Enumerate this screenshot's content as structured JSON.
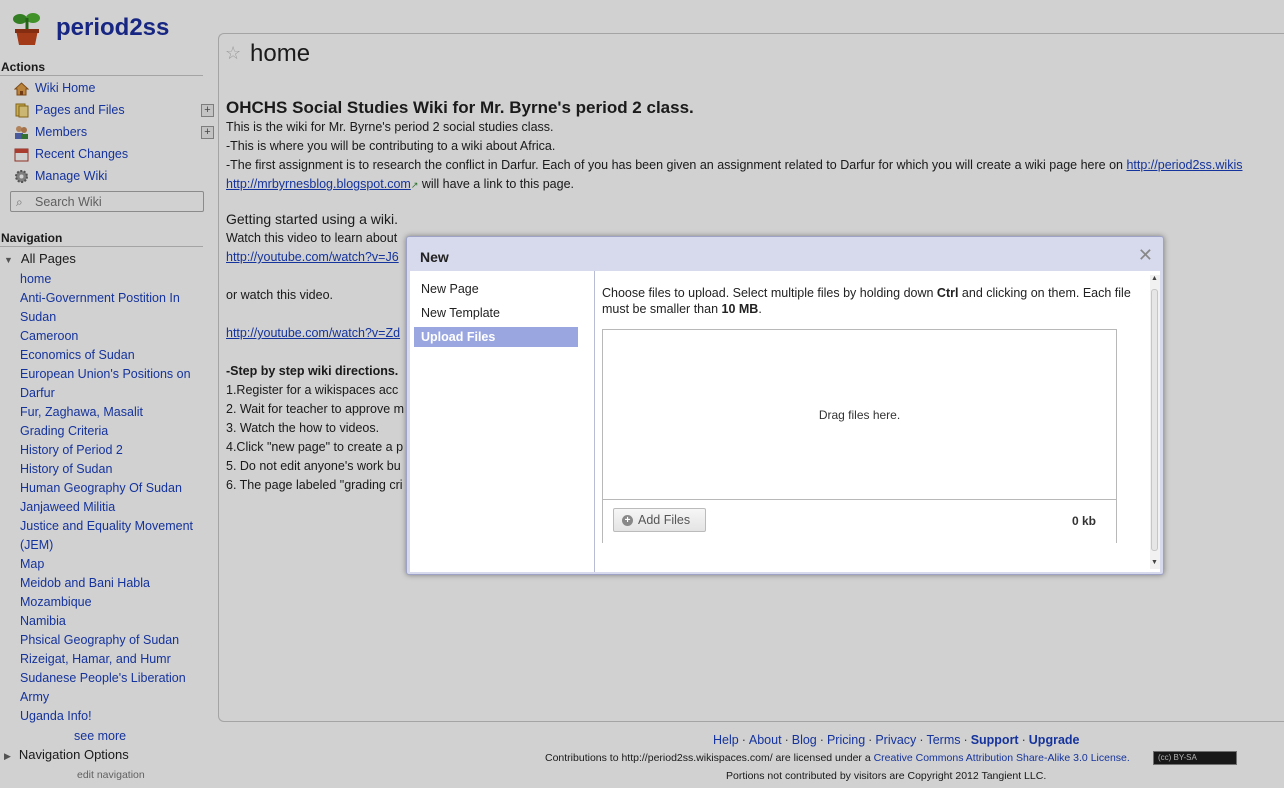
{
  "site": {
    "name": "period2ss"
  },
  "sidebar": {
    "actions_heading": "Actions",
    "actions": [
      {
        "label": "Wiki Home",
        "icon": "house-icon",
        "color": "#d9822b"
      },
      {
        "label": "Pages and Files",
        "icon": "files-icon",
        "color": "#e0b030"
      },
      {
        "label": "Members",
        "icon": "members-icon",
        "color": "#6a7fbf"
      },
      {
        "label": "Recent Changes",
        "icon": "calendar-icon",
        "color": "#d04a3a"
      },
      {
        "label": "Manage Wiki",
        "icon": "gear-icon",
        "color": "#8a8a8a"
      }
    ],
    "search_placeholder": "Search Wiki",
    "navigation_heading": "Navigation",
    "all_pages_label": "All Pages",
    "pages": [
      "home",
      "Anti-Government Postition In",
      "Sudan",
      "Cameroon",
      "Economics of Sudan",
      "European Union's Positions on",
      "Darfur",
      "Fur, Zaghawa, Masalit",
      "Grading Criteria",
      "History of Period 2",
      "History of Sudan",
      "Human Geography Of Sudan",
      "Janjaweed Militia",
      "Justice and Equality Movement",
      "(JEM)",
      "Map",
      "Meidob and Bani Habla",
      "Mozambique",
      "Namibia",
      "Phsical Geography of Sudan",
      "Rizeigat, Hamar, and Humr",
      "Sudanese People's Liberation",
      "Army",
      "Uganda Info!"
    ],
    "see_more": "see more",
    "navigation_options": "Navigation Options",
    "edit_navigation": "edit navigation"
  },
  "main": {
    "title": "home",
    "heading": "OHCHS Social Studies Wiki for Mr. Byrne's period 2 class.",
    "line1": "This is the wiki for Mr. Byrne's period 2 social studies class.",
    "line2": "-This is where you will be contributing to a wiki about Africa.",
    "line3": "-The first assignment is to research the conflict in Darfur. Each of you has been given an assignment related to Darfur for which you will create a wiki page here on",
    "line3_link": "http://period2ss.wikis",
    "blog_link": "http://mrbyrnesblog.blogspot.com",
    "line4_rest": " will have a link to this page.",
    "getting_started": "Getting started using a wiki.",
    "watch_video": "Watch this video to learn about",
    "youtube1": "http://youtube.com/watch?v=J6",
    "or_watch": "or watch this video.",
    "youtube2": "http://youtube.com/watch?v=Zd",
    "steps_heading": "-Step by step wiki directions.",
    "steps": [
      "1.Register for a wikispaces acc",
      "2. Wait for teacher to approve m",
      "3. Watch the how to videos.",
      "4.Click \"new page\" to create a p",
      "5. Do not edit anyone's work bu",
      "6. The page labeled \"grading cri"
    ]
  },
  "dialog": {
    "title": "New",
    "menu": [
      "New Page",
      "New Template",
      "Upload Files"
    ],
    "selected_menu": "Upload Files",
    "instr_a": "Choose files to upload. Select multiple files by holding down ",
    "instr_ctrl": "Ctrl",
    "instr_b": " and clicking on them. Each file must be smaller than ",
    "instr_size": "10 MB",
    "instr_c": ".",
    "drop_text": "Drag files here.",
    "add_files": "Add Files",
    "total_size": "0 kb"
  },
  "footer": {
    "links": [
      "Help",
      "About",
      "Blog",
      "Pricing",
      "Privacy",
      "Terms",
      "Support",
      "Upgrade"
    ],
    "contrib_text": "Contributions to http://period2ss.wikispaces.com/ are licensed under a ",
    "license_link": "Creative Commons Attribution Share-Alike 3.0 License.",
    "cc_badge": "(cc) BY-SA",
    "copyright": "Portions not contributed by visitors are Copyright 2012 Tangient LLC."
  }
}
